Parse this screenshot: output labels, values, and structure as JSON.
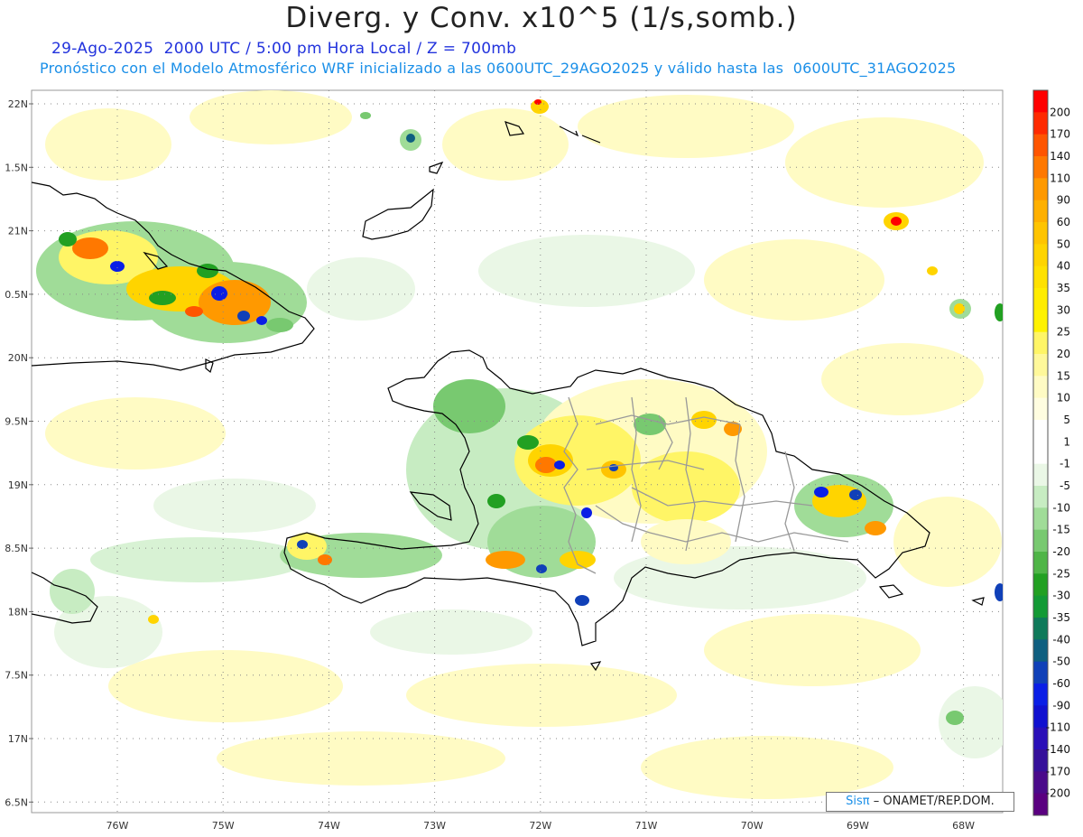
{
  "title": "Diverg. y Conv. x10^5 (1/s,somb.)",
  "subtitle_line1": "29-Ago-2025  2000 UTC / 5:00 pm Hora Local / Z = 700mb",
  "subtitle_line2": "Pronóstico con el Modelo Atmosférico WRF inicializado a las 0600UTC_29AGO2025 y válido hasta las  0600UTC_31AGO2025",
  "credit": {
    "brand": "Sisπ",
    "text": "– ONAMET/REP.DOM."
  },
  "lat_labels": [
    "22N",
    "1.5N",
    "21N",
    "0.5N",
    "20N",
    "9.5N",
    "19N",
    "8.5N",
    "18N",
    "7.5N",
    "17N",
    "6.5N"
  ],
  "lon_labels": [
    "76W",
    "75W",
    "74W",
    "73W",
    "72W",
    "71W",
    "70W",
    "69W",
    "68W"
  ],
  "colorbar": {
    "labels": [
      "200",
      "170",
      "140",
      "110",
      "90",
      "60",
      "50",
      "40",
      "35",
      "30",
      "25",
      "20",
      "15",
      "10",
      "5",
      "1",
      "-1",
      "-5",
      "-10",
      "-15",
      "-20",
      "-25",
      "-30",
      "-35",
      "-40",
      "-50",
      "-60",
      "-90",
      "-110",
      "-140",
      "-170",
      "-200"
    ],
    "colors": [
      "#ff0000",
      "#ff2a00",
      "#ff5500",
      "#ff7800",
      "#ff9900",
      "#ffb000",
      "#ffc400",
      "#ffd400",
      "#ffe100",
      "#ffec00",
      "#fff200",
      "#fff566",
      "#fff89a",
      "#fffbc4",
      "#fffde0",
      "#ffffff",
      "#ffffff",
      "#eaf7e6",
      "#c7ecc2",
      "#a0dc98",
      "#78c970",
      "#4fb547",
      "#22a022",
      "#139a35",
      "#0f7a5a",
      "#0f5f80",
      "#1040b8",
      "#0a1ee6",
      "#1010d0",
      "#2a0fb8",
      "#35109a",
      "#4a0a8a",
      "#5a0080"
    ]
  },
  "map_features": [
    "haiti-coast",
    "dominican-republic-coast",
    "cuba-east-coast",
    "great-inagua-island",
    "jamaica-east-tip",
    "dr-province-borders"
  ]
}
